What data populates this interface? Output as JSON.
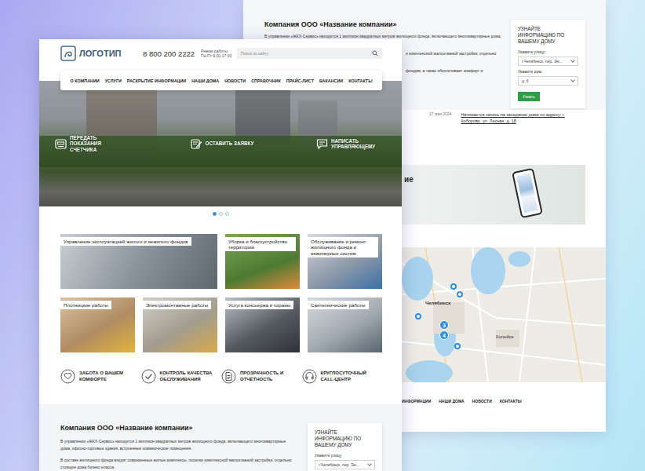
{
  "back_page": {
    "about": {
      "title": "Компания ООО «Название компании»",
      "lines": [
        "В управлении «ЖКХ-Сервис» находится 1 миллион квадратных метров жилищного фонда, включающего многоквартирные дома,",
        "и комплексной малоэтажной застройки, отдельно",
        "фондом, а также обеспечивает комфорт и"
      ]
    },
    "house_form": {
      "title": "УЗНАЙТЕ ИНФОРМАЦИЮ ПО ВАШЕМУ ДОМУ",
      "street_label": "Укажите улицу:",
      "street_value": "г.Челябинск, пер. Эн...",
      "house_label": "Укажите дом:",
      "house_value": "д. 6",
      "button": "Узнать"
    },
    "news": {
      "date": "17 мая 2024",
      "title": "Начинается запись на заседание дома по адресу: г. Коборово, ул. Лесная, д. 18"
    },
    "app_banner": {
      "title": "ие"
    },
    "map": {
      "labels": [
        "Челябинск",
        "Копейск"
      ],
      "pins": [
        {
          "kind": "pin",
          "label": ""
        },
        {
          "kind": "pin",
          "label": ""
        },
        {
          "kind": "pin",
          "label": ""
        },
        {
          "kind": "cluster",
          "label": "3"
        },
        {
          "kind": "cluster",
          "label": "4"
        },
        {
          "kind": "pin",
          "label": ""
        }
      ]
    },
    "footer_nav": [
      "ИНФОРМАЦИИ",
      "НАШИ ДОМА",
      "НОВОСТИ",
      "КОНТАКТЫ"
    ]
  },
  "front_page": {
    "logo": "ЛОГОТИП",
    "phone": "8 800 200 2222",
    "hours": [
      "Режим работы:",
      "Пн-Пт 9:00-17:00"
    ],
    "search": {
      "placeholder": "Поиск по сайту"
    },
    "nav": [
      "О КОМПАНИИ",
      "УСЛУГИ",
      "РАСКРЫТИЕ ИНФОРМАЦИИ",
      "НАШИ ДОМА",
      "НОВОСТИ",
      "СПРАВОЧНИК",
      "ПРАЙС-ЛИСТ",
      "ВАКАНСИИ",
      "КОНТАКТЫ"
    ],
    "hero_actions": [
      {
        "label": "ПЕРЕДАТЬ ПОКАЗАНИЯ СЧЕТЧИКА",
        "kind": "meter"
      },
      {
        "label": "ОСТАВИТЬ ЗАЯВКУ",
        "kind": "request"
      },
      {
        "label": "НАПИСАТЬ УПРАВЛЯЮЩЕМУ",
        "kind": "message"
      }
    ],
    "slides": [
      {
        "selected": true
      },
      {
        "selected": false
      },
      {
        "selected": false
      }
    ],
    "services": [
      "Управление эксплуатацией жилого и нежилого фондов",
      "Уборка и благоустройство территории",
      "Обслуживание и ремонт жилищного фонда и инженерных систем",
      "Плотницкие работы",
      "Электромонтажные работы",
      "Услуга консьержа и охраны",
      "Сантехнические работы"
    ],
    "features": [
      {
        "label": "ЗАБОТА О ВАШЕМ КОМФОРТЕ",
        "kind": "care"
      },
      {
        "label": "КОНТРОЛЬ КАЧЕСТВА ОБСЛУЖИВАНИЯ",
        "kind": "quality"
      },
      {
        "label": "ПРОЗРАЧНОСТЬ И ОТЧЁТНОСТЬ",
        "kind": "report"
      },
      {
        "label": "КРУГЛОСУТОЧНЫЙ CALL-ЦЕНТР",
        "kind": "call"
      }
    ],
    "about": {
      "title": "Компания ООО «Название компании»",
      "paragraphs": [
        "В управлении «ЖКХ-Сервис» находится 1 миллион квадратных метров жилищного фонда, включающего многоквартирные дома, офисно-торговые здания, встроенные коммерческие помещения.",
        "В составе жилищного фонда входят современные жилые комплексы, поселки комплексной малоэтажной застройки, отдельно стоящие дома бизнес-класса."
      ]
    },
    "house_form": {
      "title": "УЗНАЙТЕ ИНФОРМАЦИЮ ПО ВАШЕМУ ДОМУ",
      "street_label": "Укажите улицу:",
      "street_value": "г.Челябинск, пер. Эн..."
    }
  }
}
